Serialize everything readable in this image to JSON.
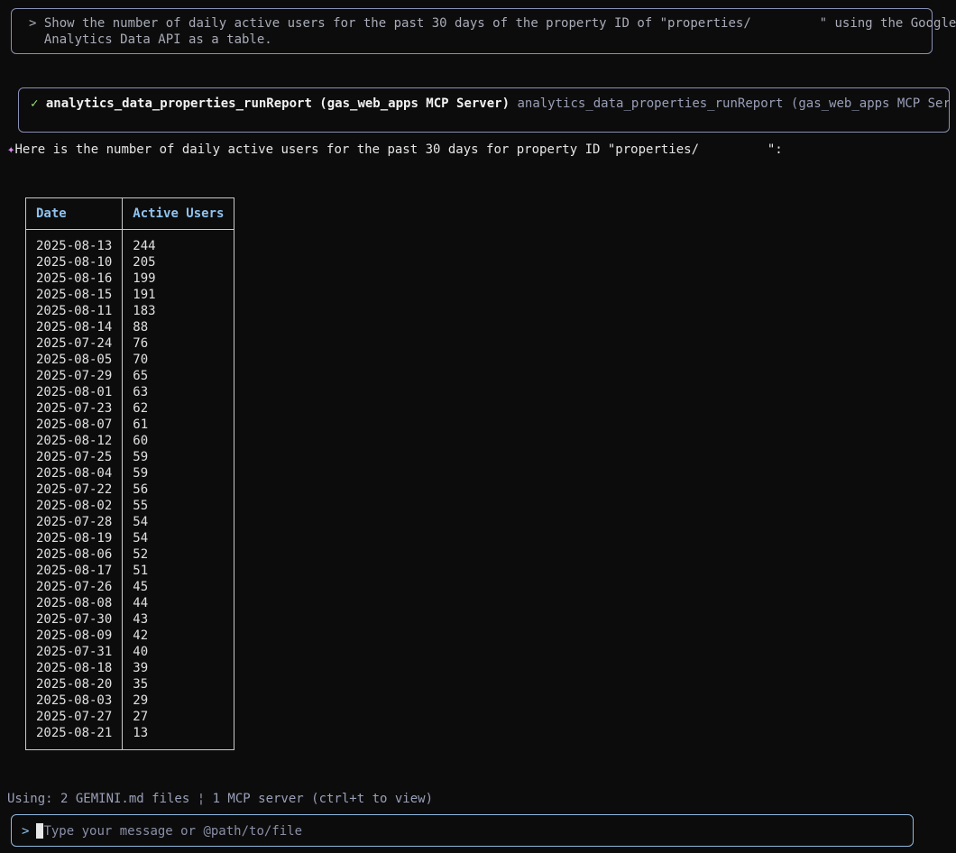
{
  "prompt": {
    "caret": ">",
    "line1": "Show the number of daily active users for the past 30 days of the property ID of \"properties/         \" using the Google",
    "line2": "Analytics Data API as a table."
  },
  "tool_call": {
    "name": "analytics_data_properties_runReport (gas_web_apps MCP Server)",
    "description": "analytics_data_properties_runReport (gas_web_apps MCP Server)",
    "icon": "check-icon"
  },
  "response": {
    "text": "Here is the number of daily active users for the past 30 days for property ID \"properties/         \":"
  },
  "table": {
    "headers": [
      "Date",
      "Active Users"
    ],
    "rows": [
      [
        "2025-08-13",
        "244"
      ],
      [
        "2025-08-10",
        "205"
      ],
      [
        "2025-08-16",
        "199"
      ],
      [
        "2025-08-15",
        "191"
      ],
      [
        "2025-08-11",
        "183"
      ],
      [
        "2025-08-14",
        "88"
      ],
      [
        "2025-07-24",
        "76"
      ],
      [
        "2025-08-05",
        "70"
      ],
      [
        "2025-07-29",
        "65"
      ],
      [
        "2025-08-01",
        "63"
      ],
      [
        "2025-07-23",
        "62"
      ],
      [
        "2025-08-07",
        "61"
      ],
      [
        "2025-08-12",
        "60"
      ],
      [
        "2025-07-25",
        "59"
      ],
      [
        "2025-08-04",
        "59"
      ],
      [
        "2025-07-22",
        "56"
      ],
      [
        "2025-08-02",
        "55"
      ],
      [
        "2025-07-28",
        "54"
      ],
      [
        "2025-08-19",
        "54"
      ],
      [
        "2025-08-06",
        "52"
      ],
      [
        "2025-08-17",
        "51"
      ],
      [
        "2025-07-26",
        "45"
      ],
      [
        "2025-08-08",
        "44"
      ],
      [
        "2025-07-30",
        "43"
      ],
      [
        "2025-08-09",
        "42"
      ],
      [
        "2025-07-31",
        "40"
      ],
      [
        "2025-08-18",
        "39"
      ],
      [
        "2025-08-20",
        "35"
      ],
      [
        "2025-08-03",
        "29"
      ],
      [
        "2025-07-27",
        "27"
      ],
      [
        "2025-08-21",
        "13"
      ]
    ]
  },
  "status": {
    "text": "Using: 2 GEMINI.md files ¦ 1 MCP server (ctrl+t to view)"
  },
  "input": {
    "caret": ">",
    "placeholder": "Type your message or @path/to/file",
    "value": ""
  },
  "colors": {
    "background": "#0c0c0c",
    "border": "#8a8fb4",
    "header": "#8fc3ef",
    "check": "#98e37a",
    "sparkle": "#d98ff0"
  }
}
